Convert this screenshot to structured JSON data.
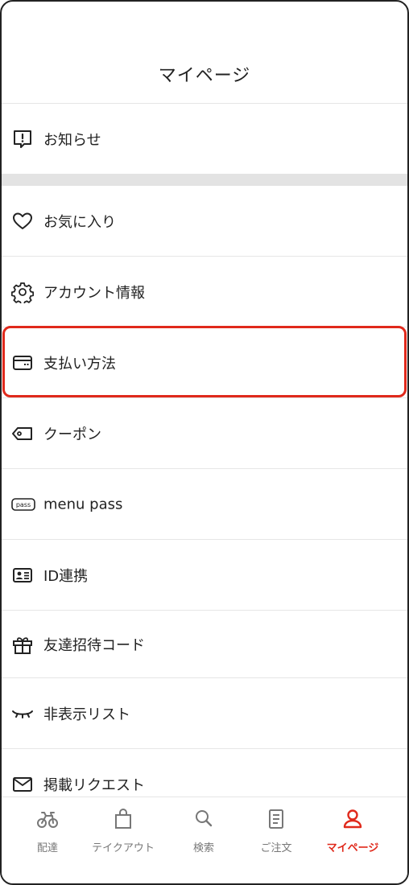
{
  "header": {
    "title": "マイページ"
  },
  "menu": {
    "items": [
      {
        "name": "notice",
        "icon": "notice-icon",
        "label": "お知らせ"
      },
      {
        "name": "favorites",
        "icon": "heart-icon",
        "label": "お気に入り"
      },
      {
        "name": "account",
        "icon": "gear-icon",
        "label": "アカウント情報"
      },
      {
        "name": "payment",
        "icon": "card-icon",
        "label": "支払い方法"
      },
      {
        "name": "coupon",
        "icon": "tag-icon",
        "label": "クーポン"
      },
      {
        "name": "menupass",
        "icon": "pass-icon",
        "label": "menu pass"
      },
      {
        "name": "idlink",
        "icon": "id-card-icon",
        "label": "ID連携"
      },
      {
        "name": "invite",
        "icon": "gift-icon",
        "label": "友達招待コード"
      },
      {
        "name": "hidden",
        "icon": "closed-eye-icon",
        "label": "非表示リスト"
      },
      {
        "name": "request",
        "icon": "mail-icon",
        "label": "掲載リクエスト"
      }
    ],
    "pass_icon_text": "pass"
  },
  "tabbar": {
    "tabs": [
      {
        "label": "配達",
        "icon": "bicycle-icon"
      },
      {
        "label": "テイクアウト",
        "icon": "bag-icon"
      },
      {
        "label": "検索",
        "icon": "search-icon"
      },
      {
        "label": "ご注文",
        "icon": "receipt-icon"
      },
      {
        "label": "マイページ",
        "icon": "person-icon",
        "active": true
      }
    ]
  },
  "colors": {
    "accent": "#e0291b",
    "text": "#222222",
    "muted": "#777777",
    "divider": "#e6e6e6"
  }
}
